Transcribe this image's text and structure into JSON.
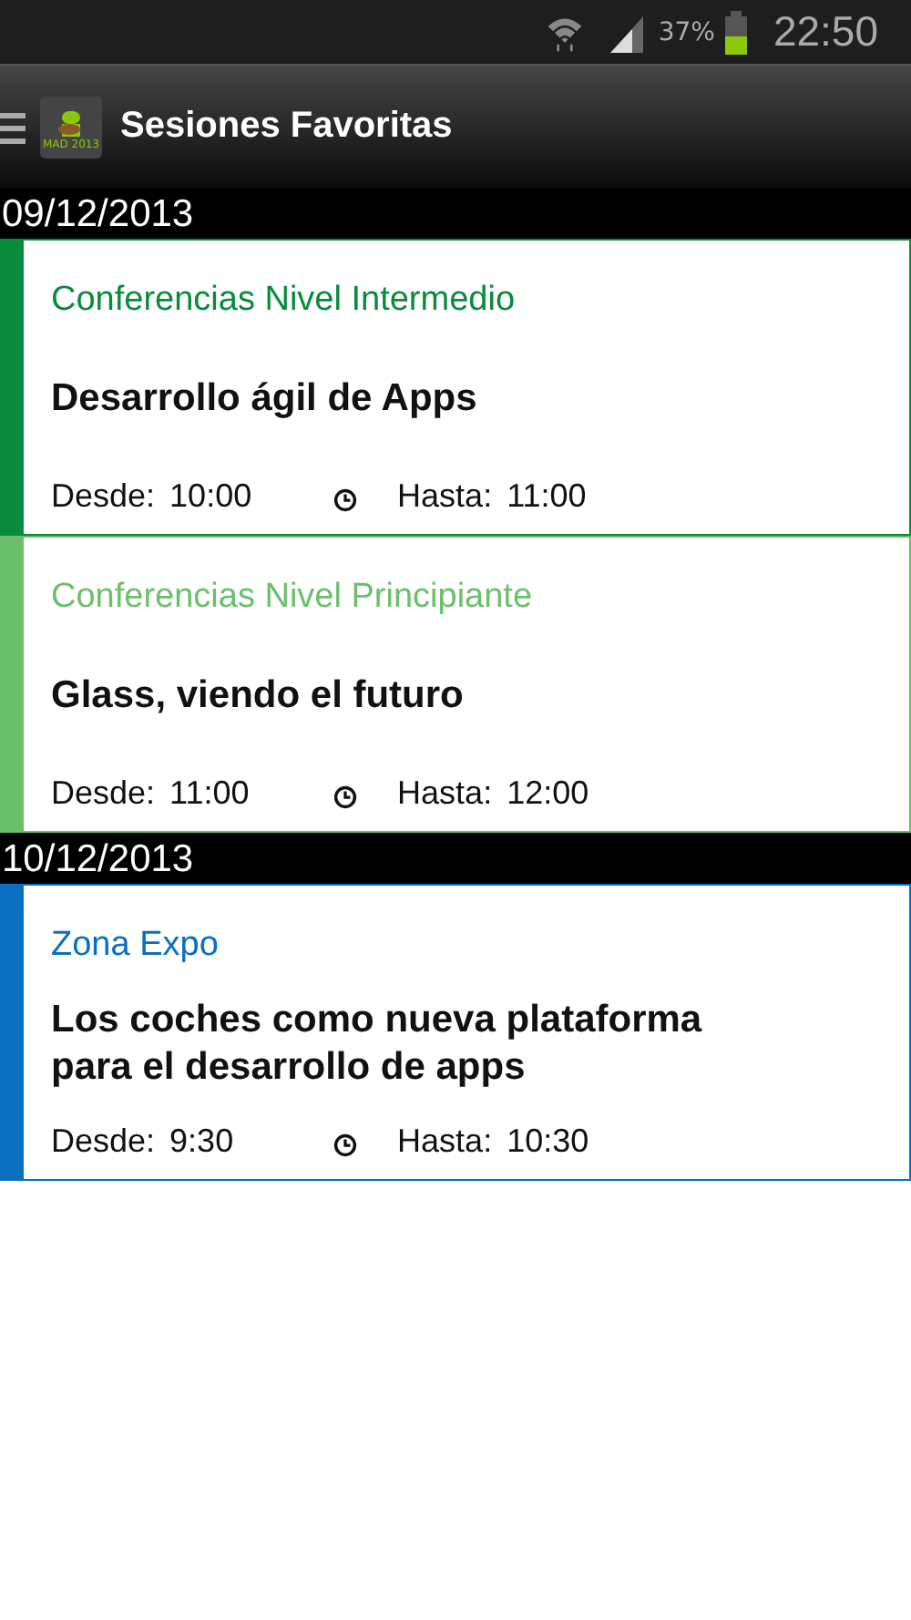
{
  "status_bar": {
    "battery": "37%",
    "time": "22:50"
  },
  "app_bar": {
    "title": "Sesiones Favoritas",
    "logo_caption": "MAD 2013"
  },
  "days": [
    {
      "date": "09/12/2013",
      "sessions": [
        {
          "track": "Conferencias Nivel Intermedio",
          "color": "#0a8a3c",
          "title": "Desarrollo ágil de Apps",
          "from_label": "Desde:",
          "from": "10:00",
          "to_label": "Hasta:",
          "to": "11:00"
        },
        {
          "track": "Conferencias Nivel Principiante",
          "color": "#6cbf6c",
          "title": "Glass, viendo el futuro",
          "from_label": "Desde:",
          "from": "11:00",
          "to_label": "Hasta:",
          "to": "12:00"
        }
      ]
    },
    {
      "date": "10/12/2013",
      "sessions": [
        {
          "track": "Zona Expo",
          "color": "#0a6fc0",
          "title": "Los coches como nueva plataforma para el desarrollo de apps",
          "from_label": "Desde:",
          "from": "9:30",
          "to_label": "Hasta:",
          "to": "10:30"
        }
      ]
    }
  ]
}
